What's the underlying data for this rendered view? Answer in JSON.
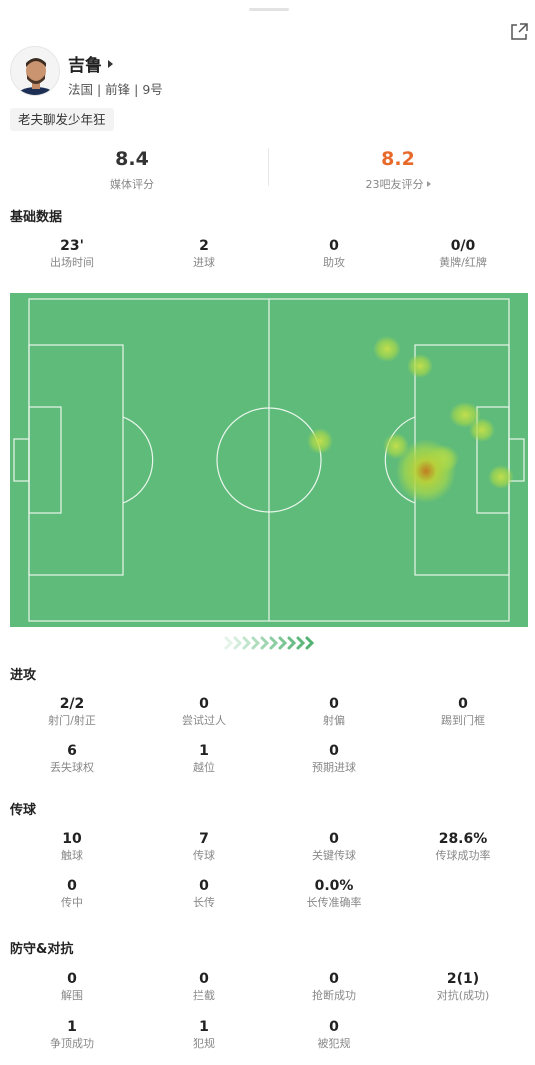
{
  "player": {
    "name": "吉鲁",
    "meta": "法国 | 前锋 | 9号",
    "tag": "老夫聊发少年狂"
  },
  "ratings": {
    "media": {
      "value": "8.4",
      "label": "媒体评分"
    },
    "fans": {
      "value": "8.2",
      "label": "23吧友评分"
    }
  },
  "sections": {
    "basic": {
      "title": "基础数据",
      "row1": [
        {
          "value": "23'",
          "label": "出场时间"
        },
        {
          "value": "2",
          "label": "进球"
        },
        {
          "value": "0",
          "label": "助攻"
        },
        {
          "value": "0/0",
          "label": "黄牌/红牌"
        }
      ]
    },
    "attack": {
      "title": "进攻",
      "row1": [
        {
          "value": "2/2",
          "label": "射门/射正"
        },
        {
          "value": "0",
          "label": "尝试过人"
        },
        {
          "value": "0",
          "label": "射偏"
        },
        {
          "value": "0",
          "label": "踢到门框"
        }
      ],
      "row2": [
        {
          "value": "6",
          "label": "丢失球权"
        },
        {
          "value": "1",
          "label": "越位"
        },
        {
          "value": "0",
          "label": "预期进球"
        }
      ]
    },
    "passing": {
      "title": "传球",
      "row1": [
        {
          "value": "10",
          "label": "触球"
        },
        {
          "value": "7",
          "label": "传球"
        },
        {
          "value": "0",
          "label": "关键传球"
        },
        {
          "value": "28.6%",
          "label": "传球成功率"
        }
      ],
      "row2": [
        {
          "value": "0",
          "label": "传中"
        },
        {
          "value": "0",
          "label": "长传"
        },
        {
          "value": "0.0%",
          "label": "长传准确率"
        }
      ]
    },
    "defense": {
      "title": "防守&对抗",
      "row1": [
        {
          "value": "0",
          "label": "解围"
        },
        {
          "value": "0",
          "label": "拦截"
        },
        {
          "value": "0",
          "label": "抢断成功"
        },
        {
          "value": "2(1)",
          "label": "对抗(成功)"
        }
      ],
      "row2": [
        {
          "value": "1",
          "label": "争顶成功"
        },
        {
          "value": "1",
          "label": "犯规"
        },
        {
          "value": "0",
          "label": "被犯规"
        }
      ]
    }
  },
  "heatmap": {
    "pitch_color": "#5fbb7a",
    "line_color": "#e9f6ec"
  },
  "icons": {
    "share": "share-icon",
    "avatar": "player-avatar",
    "chevrons": "chevron-right-icons"
  }
}
